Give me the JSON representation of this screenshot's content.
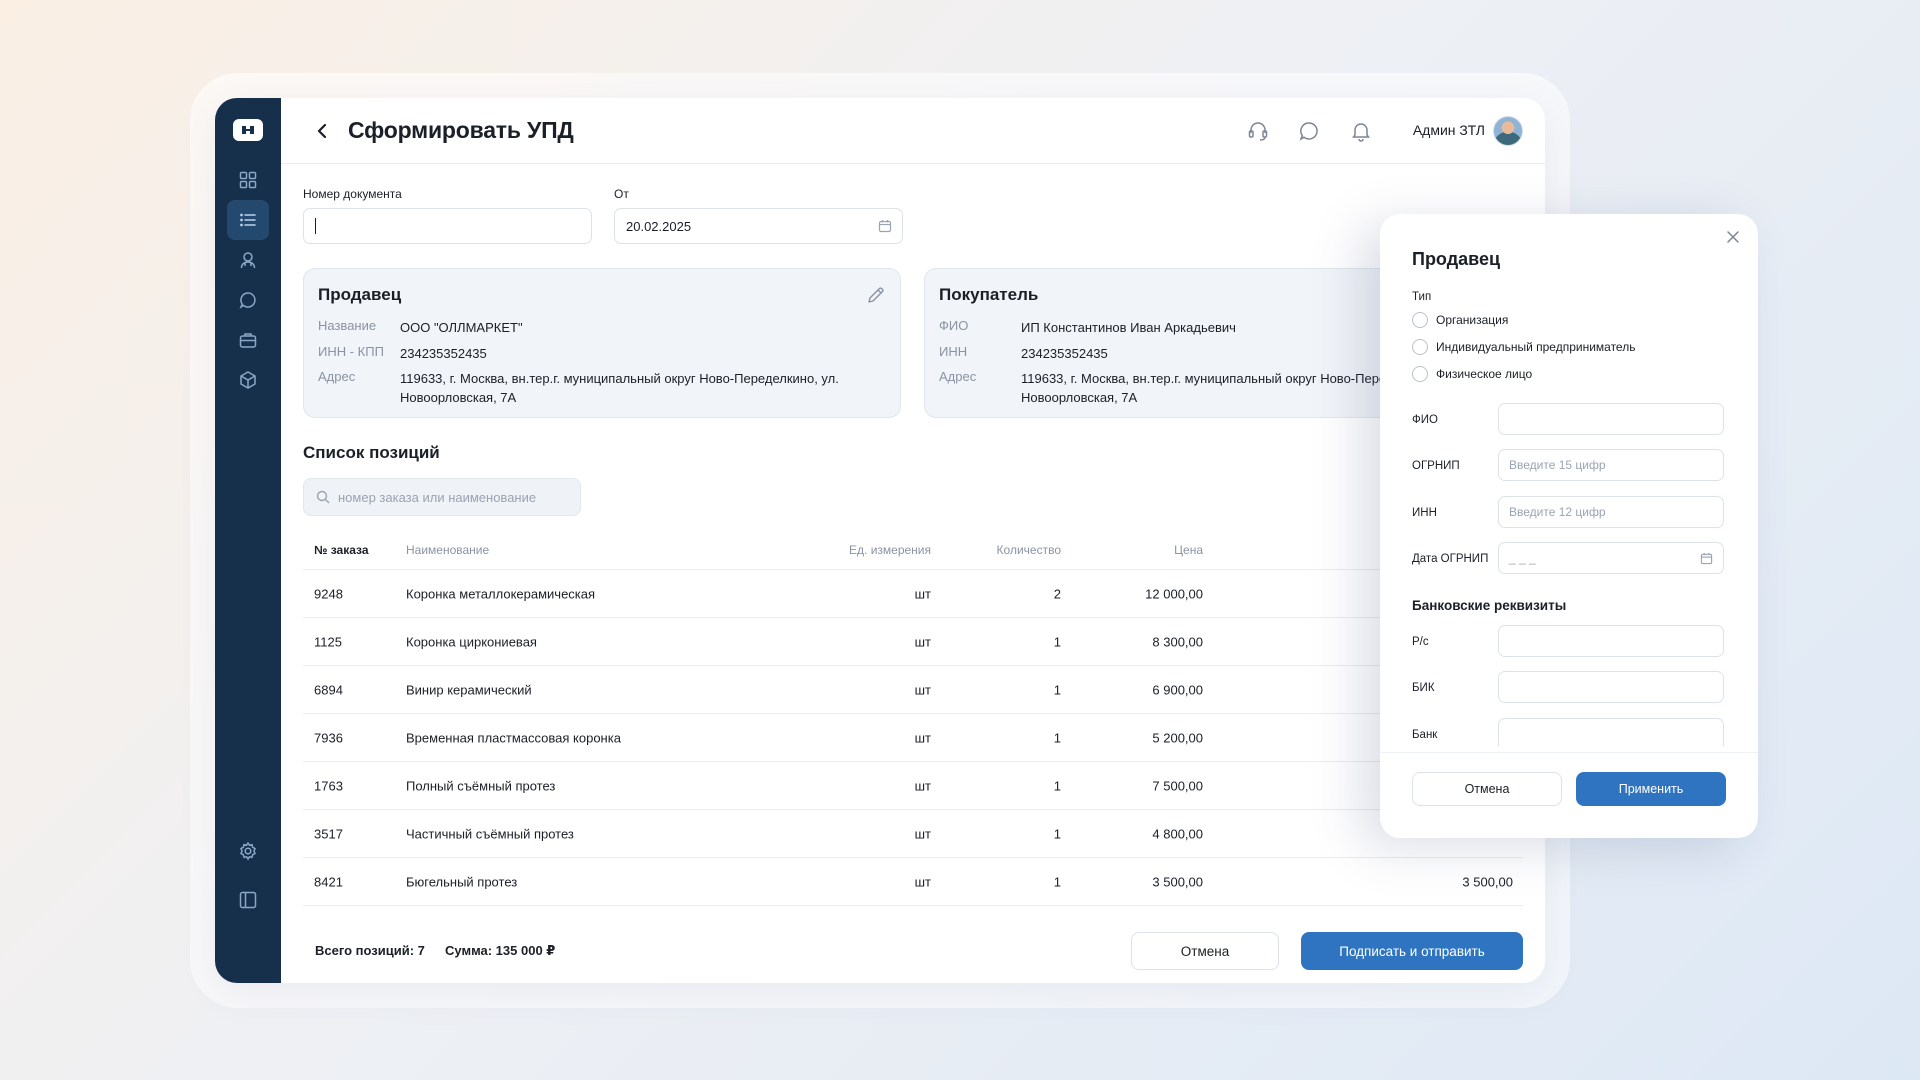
{
  "header": {
    "title": "Сформировать УПД",
    "user_name": "Админ ЗТЛ"
  },
  "form": {
    "doc_number_label": "Номер документа",
    "doc_number_value": "",
    "date_label": "От",
    "date_value": "20.02.2025"
  },
  "seller": {
    "title": "Продавец",
    "rows": [
      {
        "k": "Название",
        "v": "ООО \"ОЛЛМАРКЕТ\""
      },
      {
        "k": "ИНН - КПП",
        "v": "234235352435"
      },
      {
        "k": "Адрес",
        "v": "119633, г. Москва, вн.тер.г. муниципальный округ Ново-Переделкино, ул. Новоорловская, 7А"
      }
    ]
  },
  "buyer": {
    "title": "Покупатель",
    "rows": [
      {
        "k": "ФИО",
        "v": "ИП Константинов Иван Аркадьевич"
      },
      {
        "k": "ИНН",
        "v": "234235352435"
      },
      {
        "k": "Адрес",
        "v": "119633, г. Москва, вн.тер.г. муниципальный округ Ново-Переделкино, ул. Новоорловская, 7А"
      }
    ]
  },
  "list": {
    "title": "Список позиций",
    "search_placeholder": "номер заказа или наименование",
    "columns": {
      "num": "№ заказа",
      "name": "Наименование",
      "unit": "Ед. измерения",
      "qty": "Количество",
      "price": "Цена"
    },
    "rows": [
      {
        "num": "9248",
        "name": "Коронка металлокерамическая",
        "unit": "шт",
        "qty": "2",
        "price": "12 000,00",
        "total": ""
      },
      {
        "num": "1125",
        "name": "Коронка циркониевая",
        "unit": "шт",
        "qty": "1",
        "price": "8 300,00",
        "total": ""
      },
      {
        "num": "6894",
        "name": "Винир керамический",
        "unit": "шт",
        "qty": "1",
        "price": "6 900,00",
        "total": ""
      },
      {
        "num": "7936",
        "name": "Временная пластмассовая коронка",
        "unit": "шт",
        "qty": "1",
        "price": "5 200,00",
        "total": ""
      },
      {
        "num": "1763",
        "name": "Полный съёмный протез",
        "unit": "шт",
        "qty": "1",
        "price": "7 500,00",
        "total": ""
      },
      {
        "num": "3517",
        "name": "Частичный съёмный протез",
        "unit": "шт",
        "qty": "1",
        "price": "4 800,00",
        "total": ""
      },
      {
        "num": "8421",
        "name": "Бюгельный протез",
        "unit": "шт",
        "qty": "1",
        "price": "3 500,00",
        "total": "3 500,00"
      }
    ]
  },
  "footer": {
    "total_positions": "Всего позиций: 7",
    "sum": "Сумма: 135 000 ₽",
    "cancel": "Отмена",
    "submit": "Подписать и отправить"
  },
  "modal": {
    "title": "Продавец",
    "type_label": "Тип",
    "types": [
      "Организация",
      "Индивидуальный предприниматель",
      "Физическое лицо"
    ],
    "fio_label": "ФИО",
    "ogrnip_label": "ОГРНИП",
    "ogrnip_placeholder": "Введите 15 цифр",
    "inn_label": "ИНН",
    "inn_placeholder": "Введите 12 цифр",
    "ogrnip_date_label": "Дата ОГРНИП",
    "ogrnip_date_placeholder": "_ _ _",
    "bank_section": "Банковские реквизиты",
    "rs_label": "Р/с",
    "bik_label": "БИК",
    "bank_label": "Банк",
    "cancel": "Отмена",
    "apply": "Применить"
  },
  "colors": {
    "sidebar": "#16304c",
    "accent": "#2f74c0"
  }
}
